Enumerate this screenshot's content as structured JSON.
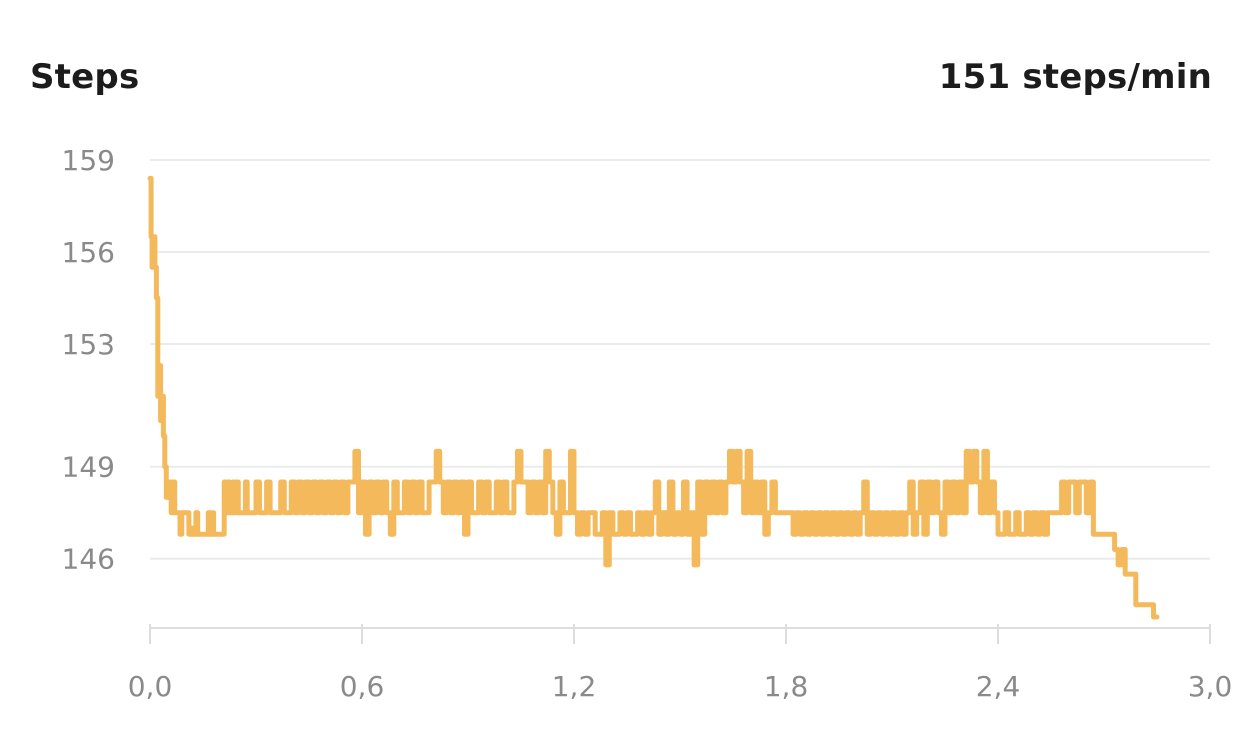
{
  "header": {
    "title": "Steps",
    "current_value": "151 steps/min"
  },
  "colors": {
    "line": "#F4B95B",
    "grid": "#EBEBEB",
    "axis": "#DDDDDD",
    "tick_text": "#8A8A8A",
    "title_text": "#1C1C1C"
  },
  "chart_data": {
    "type": "line",
    "title": "Steps",
    "xlabel": "",
    "ylabel": "",
    "xlim": [
      0,
      3.0
    ],
    "ylim": [
      144.1,
      159
    ],
    "x_ticks": [
      0,
      0.6,
      1.2,
      1.8,
      2.4,
      3.0
    ],
    "x_tick_labels": [
      "0,0",
      "0,6",
      "1,2",
      "1,8",
      "2,4",
      "3,0"
    ],
    "y_ticks": [
      146,
      149,
      153,
      156,
      159
    ],
    "y_tick_labels": [
      "146",
      "149",
      "153",
      "156",
      "159"
    ],
    "grid": true,
    "series": [
      {
        "values_x": [
          0.0,
          0.003,
          0.006,
          0.01,
          0.014,
          0.018,
          0.022,
          0.026,
          0.03,
          0.034,
          0.038,
          0.042,
          0.046,
          0.05,
          0.055,
          0.06,
          0.065,
          0.07,
          0.075,
          0.08,
          0.085,
          0.09,
          0.095,
          0.1,
          0.105,
          0.11,
          0.115,
          0.12,
          0.125,
          0.13,
          0.135,
          0.14,
          0.145,
          0.15,
          0.155,
          0.16,
          0.165,
          0.17,
          0.175,
          0.18,
          0.185,
          0.19,
          0.195,
          0.2,
          0.205,
          0.21,
          0.215,
          0.22,
          0.225,
          0.23,
          0.235,
          0.24,
          0.245,
          0.25,
          0.255,
          0.26,
          0.265,
          0.27,
          0.275,
          0.28,
          0.285,
          0.29,
          0.295,
          0.3,
          0.31,
          0.32,
          0.33,
          0.34,
          0.35,
          0.36,
          0.37,
          0.38,
          0.39,
          0.4,
          0.41,
          0.42,
          0.43,
          0.44,
          0.45,
          0.46,
          0.47,
          0.48,
          0.49,
          0.5,
          0.51,
          0.52,
          0.53,
          0.54,
          0.55,
          0.56,
          0.57,
          0.58,
          0.59,
          0.6,
          0.61,
          0.62,
          0.63,
          0.64,
          0.65,
          0.66,
          0.67,
          0.68,
          0.69,
          0.7,
          0.71,
          0.72,
          0.73,
          0.74,
          0.75,
          0.76,
          0.77,
          0.78,
          0.79,
          0.8,
          0.81,
          0.82,
          0.83,
          0.84,
          0.85,
          0.86,
          0.87,
          0.88,
          0.89,
          0.9,
          0.91,
          0.92,
          0.93,
          0.94,
          0.95,
          0.96,
          0.97,
          0.98,
          0.99,
          1.0,
          1.01,
          1.02,
          1.03,
          1.04,
          1.05,
          1.06,
          1.07,
          1.08,
          1.09,
          1.1,
          1.11,
          1.12,
          1.13,
          1.14,
          1.15,
          1.16,
          1.17,
          1.18,
          1.19,
          1.2,
          1.21,
          1.22,
          1.23,
          1.24,
          1.25,
          1.26,
          1.27,
          1.28,
          1.29,
          1.3,
          1.31,
          1.32,
          1.33,
          1.34,
          1.35,
          1.36,
          1.37,
          1.38,
          1.39,
          1.4,
          1.41,
          1.42,
          1.43,
          1.44,
          1.45,
          1.46,
          1.47,
          1.48,
          1.49,
          1.5,
          1.51,
          1.52,
          1.53,
          1.54,
          1.55,
          1.56,
          1.57,
          1.58,
          1.59,
          1.6,
          1.61,
          1.62,
          1.63,
          1.64,
          1.65,
          1.66,
          1.67,
          1.68,
          1.69,
          1.7,
          1.71,
          1.72,
          1.73,
          1.74,
          1.75,
          1.76,
          1.77,
          1.78,
          1.79,
          1.8,
          1.81,
          1.82,
          1.83,
          1.84,
          1.85,
          1.86,
          1.87,
          1.88,
          1.89,
          1.9,
          1.91,
          1.92,
          1.93,
          1.94,
          1.95,
          1.96,
          1.97,
          1.98,
          1.99,
          2.0,
          2.01,
          2.02,
          2.03,
          2.04,
          2.05,
          2.06,
          2.07,
          2.08,
          2.09,
          2.1,
          2.11,
          2.12,
          2.13,
          2.14,
          2.15,
          2.16,
          2.17,
          2.18,
          2.19,
          2.2,
          2.21,
          2.22,
          2.23,
          2.24,
          2.25,
          2.26,
          2.27,
          2.28,
          2.29,
          2.3,
          2.31,
          2.32,
          2.33,
          2.34,
          2.35,
          2.36,
          2.37,
          2.38,
          2.39,
          2.4,
          2.41,
          2.42,
          2.43,
          2.44,
          2.45,
          2.46,
          2.47,
          2.48,
          2.49,
          2.5,
          2.51,
          2.52,
          2.53,
          2.54,
          2.55,
          2.56,
          2.57,
          2.58,
          2.59,
          2.6,
          2.61,
          2.62,
          2.63,
          2.64,
          2.65,
          2.66,
          2.67,
          2.68,
          2.69,
          2.7,
          2.71,
          2.72,
          2.73,
          2.74,
          2.75,
          2.76,
          2.77,
          2.78,
          2.79,
          2.8,
          2.81,
          2.82,
          2.83,
          2.84,
          2.85,
          2.86,
          2.87,
          2.88,
          2.89,
          2.9,
          2.91,
          2.92,
          2.93,
          2.94,
          2.95,
          2.96,
          2.97,
          2.98,
          2.99,
          3.0
        ],
        "values_y": [
          158.4,
          156.5,
          155.5,
          156.5,
          155.5,
          154.5,
          151.3,
          152.3,
          150.5,
          151.3,
          150.0,
          149.0,
          148.0,
          148.0,
          148.5,
          147.5,
          148.5,
          147.5,
          147.5,
          147.5,
          146.8,
          147.5,
          147.5,
          147.5,
          147.5,
          146.8,
          147.0,
          146.8,
          146.8,
          147.5,
          146.8,
          146.8,
          146.8,
          146.8,
          146.8,
          146.8,
          147.5,
          146.8,
          147.5,
          146.8,
          146.8,
          146.8,
          146.8,
          146.8,
          146.8,
          148.5,
          147.5,
          148.5,
          147.5,
          147.5,
          148.5,
          147.5,
          148.5,
          147.5,
          147.5,
          147.5,
          147.5,
          148.5,
          147.5,
          147.5,
          147.5,
          147.5,
          147.5,
          148.5,
          147.5,
          147.5,
          148.5,
          147.5,
          147.5,
          147.5,
          148.5,
          147.5,
          147.5,
          148.5,
          147.5,
          148.5,
          147.5,
          148.5,
          147.5,
          148.5,
          147.5,
          148.5,
          147.5,
          148.5,
          147.5,
          148.5,
          147.5,
          148.5,
          147.5,
          148.5,
          148.5,
          149.5,
          147.5,
          148.5,
          146.8,
          148.5,
          147.5,
          148.5,
          147.5,
          148.5,
          147.5,
          146.8,
          148.5,
          147.5,
          147.5,
          148.5,
          147.5,
          148.5,
          147.5,
          148.5,
          147.5,
          147.5,
          148.5,
          148.5,
          149.5,
          148.5,
          147.5,
          148.5,
          147.5,
          148.5,
          147.5,
          148.5,
          146.8,
          148.5,
          147.5,
          147.5,
          148.5,
          147.5,
          148.5,
          147.5,
          147.5,
          148.5,
          147.5,
          148.5,
          147.5,
          147.5,
          148.5,
          149.5,
          148.5,
          148.5,
          147.5,
          148.5,
          147.5,
          148.5,
          147.5,
          149.5,
          148.5,
          147.5,
          146.8,
          148.5,
          147.5,
          147.5,
          149.5,
          147.5,
          146.8,
          147.5,
          146.8,
          147.5,
          147.5,
          146.8,
          146.8,
          147.5,
          145.8,
          147.5,
          146.8,
          146.8,
          147.5,
          146.8,
          147.5,
          146.8,
          146.8,
          147.5,
          146.8,
          147.5,
          146.8,
          147.5,
          148.5,
          146.8,
          147.5,
          146.8,
          148.5,
          146.8,
          147.5,
          146.8,
          148.5,
          146.8,
          147.5,
          145.8,
          148.5,
          146.8,
          148.5,
          147.5,
          148.5,
          147.5,
          148.5,
          147.5,
          148.5,
          149.5,
          148.5,
          149.5,
          148.5,
          147.5,
          149.5,
          147.5,
          148.5,
          147.5,
          148.5,
          146.8,
          147.5,
          148.5,
          147.5,
          147.5,
          147.5,
          147.5,
          147.5,
          146.8,
          147.5,
          146.8,
          147.5,
          146.8,
          147.5,
          146.8,
          147.5,
          146.8,
          147.5,
          146.8,
          147.5,
          146.8,
          147.5,
          146.8,
          147.5,
          146.8,
          147.5,
          146.8,
          147.5,
          148.5,
          146.8,
          147.5,
          146.8,
          147.5,
          146.8,
          147.5,
          146.8,
          147.5,
          146.8,
          147.5,
          146.8,
          147.5,
          148.5,
          146.8,
          147.5,
          148.5,
          146.8,
          148.5,
          147.5,
          148.5,
          147.5,
          146.8,
          148.5,
          147.5,
          148.5,
          147.5,
          148.5,
          147.5,
          149.5,
          148.5,
          149.5,
          148.5,
          147.5,
          149.5,
          147.5,
          148.5,
          147.5,
          146.8,
          146.8,
          147.5,
          146.8,
          146.8,
          147.5,
          146.8,
          146.8,
          147.5,
          146.8,
          147.5,
          146.8,
          147.5,
          146.8,
          147.5,
          147.5,
          147.5,
          147.5,
          148.5,
          147.5,
          148.5,
          148.5,
          147.5,
          148.5,
          148.5,
          147.5,
          148.5,
          146.8,
          146.8,
          146.8,
          146.8,
          146.8,
          146.8,
          146.3,
          145.8,
          146.3,
          145.5,
          145.5,
          145.5,
          144.5,
          144.5,
          144.5,
          144.5,
          144.5,
          144.1
        ]
      }
    ]
  }
}
